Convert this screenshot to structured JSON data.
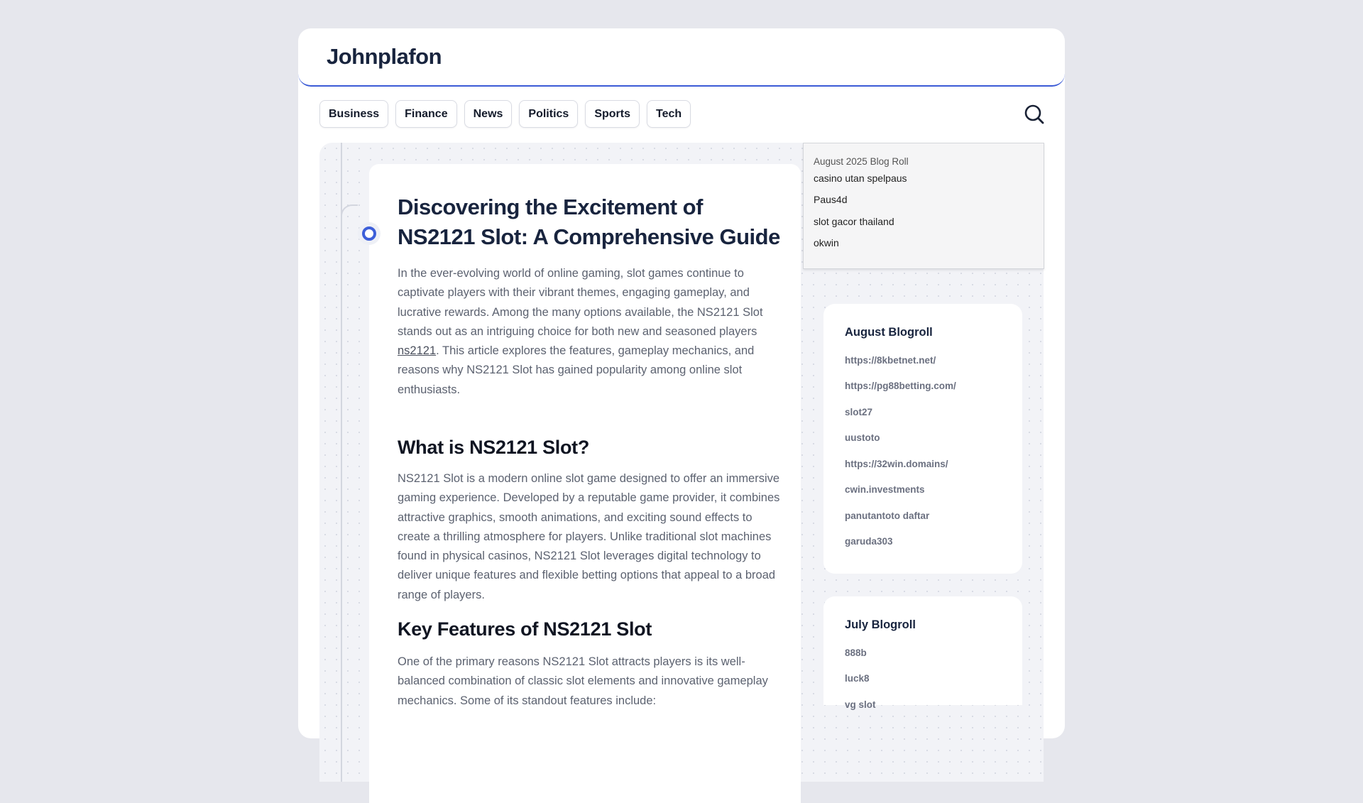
{
  "site": {
    "title": "Johnplafon"
  },
  "nav": [
    {
      "label": "Business"
    },
    {
      "label": "Finance"
    },
    {
      "label": "News"
    },
    {
      "label": "Politics"
    },
    {
      "label": "Sports"
    },
    {
      "label": "Tech"
    }
  ],
  "search": {
    "icon": "search-icon"
  },
  "article": {
    "title": "Discovering the Excitement of NS2121 Slot: A Comprehensive Guide",
    "intro_before_link": "In the ever-evolving world of online gaming, slot games continue to captivate players with their vibrant themes, engaging gameplay, and lucrative rewards. Among the many options available, the NS2121 Slot stands out as an intriguing choice for both new and seasoned players ",
    "intro_link": "ns2121",
    "intro_after_link": ". This article explores the features, gameplay mechanics, and reasons why NS2121 Slot has gained popularity among online slot enthusiasts.",
    "h2_1": "What is NS2121 Slot?",
    "p2": "NS2121 Slot is a modern online slot game designed to offer an immersive gaming experience. Developed by a reputable game provider, it combines attractive graphics, smooth animations, and exciting sound effects to create a thrilling atmosphere for players. Unlike traditional slot machines found in physical casinos, NS2121 Slot leverages digital technology to deliver unique features and flexible betting options that appeal to a broad range of players.",
    "h2_2": "Key Features of NS2121 Slot",
    "p3": "One of the primary reasons NS2121 Slot attracts players is its well-balanced combination of classic slot elements and innovative gameplay mechanics. Some of its standout features include:"
  },
  "sidebar": {
    "blogroll_box": {
      "caption": "August 2025 Blog Roll",
      "links": [
        "casino utan spelpaus",
        "Paus4d",
        "slot gacor thailand",
        "okwin"
      ]
    },
    "august": {
      "title": "August Blogroll",
      "items": [
        "https://8kbetnet.net/",
        "https://pg88betting.com/",
        "slot27",
        "uustoto",
        "https://32win.domains/",
        "cwin.investments",
        "panutantoto daftar",
        "garuda303"
      ]
    },
    "july": {
      "title": "July Blogroll",
      "items": [
        "888b",
        "luck8",
        "vg slot"
      ]
    }
  },
  "colors": {
    "accent": "#3b5bd6",
    "background": "#e6e7ed",
    "title": "#18243e"
  }
}
